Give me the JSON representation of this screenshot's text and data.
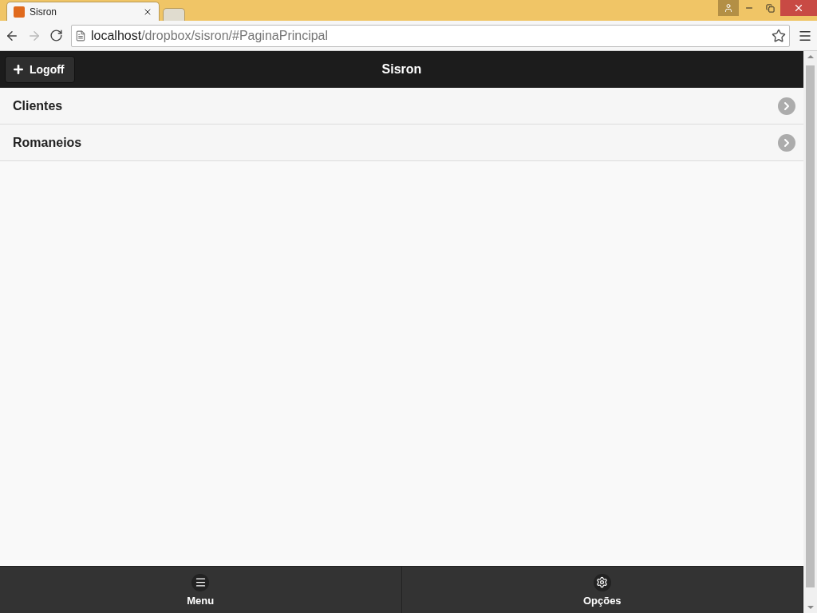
{
  "browser": {
    "tabs": [
      {
        "title": "Sisron",
        "selected": true
      },
      {
        "selected": false
      }
    ],
    "url_host": "localhost",
    "url_path": "/dropbox/sisron/#PaginaPrincipal"
  },
  "header": {
    "title": "Sisron",
    "left_button": "Logoff"
  },
  "list": [
    {
      "label": "Clientes"
    },
    {
      "label": "Romaneios"
    }
  ],
  "footer": [
    {
      "label": "Menu",
      "kind": "menu"
    },
    {
      "label": "Opções",
      "kind": "settings"
    }
  ]
}
